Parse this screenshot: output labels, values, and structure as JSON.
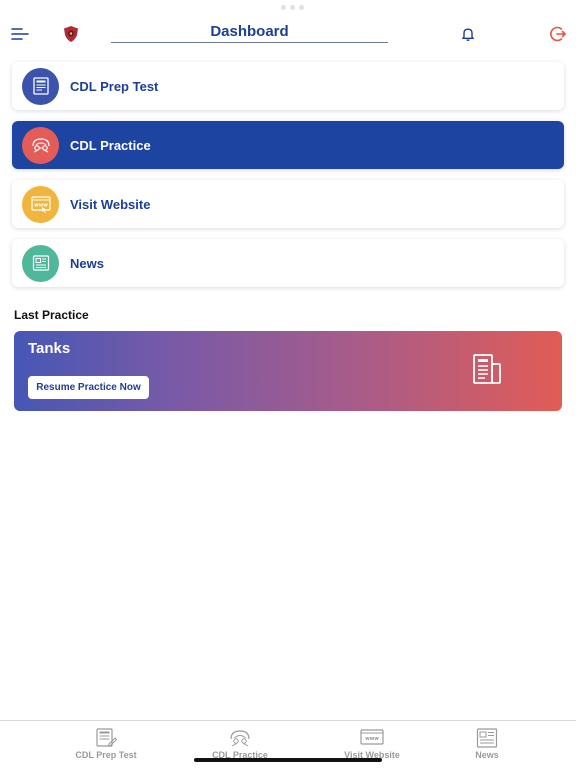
{
  "header": {
    "title": "Dashboard"
  },
  "menu": [
    {
      "label": "CDL Prep Test",
      "icon": "prep-test-icon",
      "color": "#3b53ad",
      "active": false
    },
    {
      "label": "CDL Practice",
      "icon": "practice-icon",
      "color": "#e35c58",
      "active": true
    },
    {
      "label": "Visit Website",
      "icon": "website-icon",
      "color": "#efb53c",
      "active": false
    },
    {
      "label": "News",
      "icon": "news-icon",
      "color": "#4fb89a",
      "active": false
    }
  ],
  "last_practice": {
    "section_title": "Last Practice",
    "topic": "Tanks",
    "resume_label": "Resume Practice Now"
  },
  "tabbar": [
    {
      "label": "CDL Prep Test"
    },
    {
      "label": "CDL Practice"
    },
    {
      "label": "Visit Website"
    },
    {
      "label": "News"
    }
  ],
  "colors": {
    "brand_blue": "#1d44a1",
    "text_blue": "#1d3f93"
  }
}
